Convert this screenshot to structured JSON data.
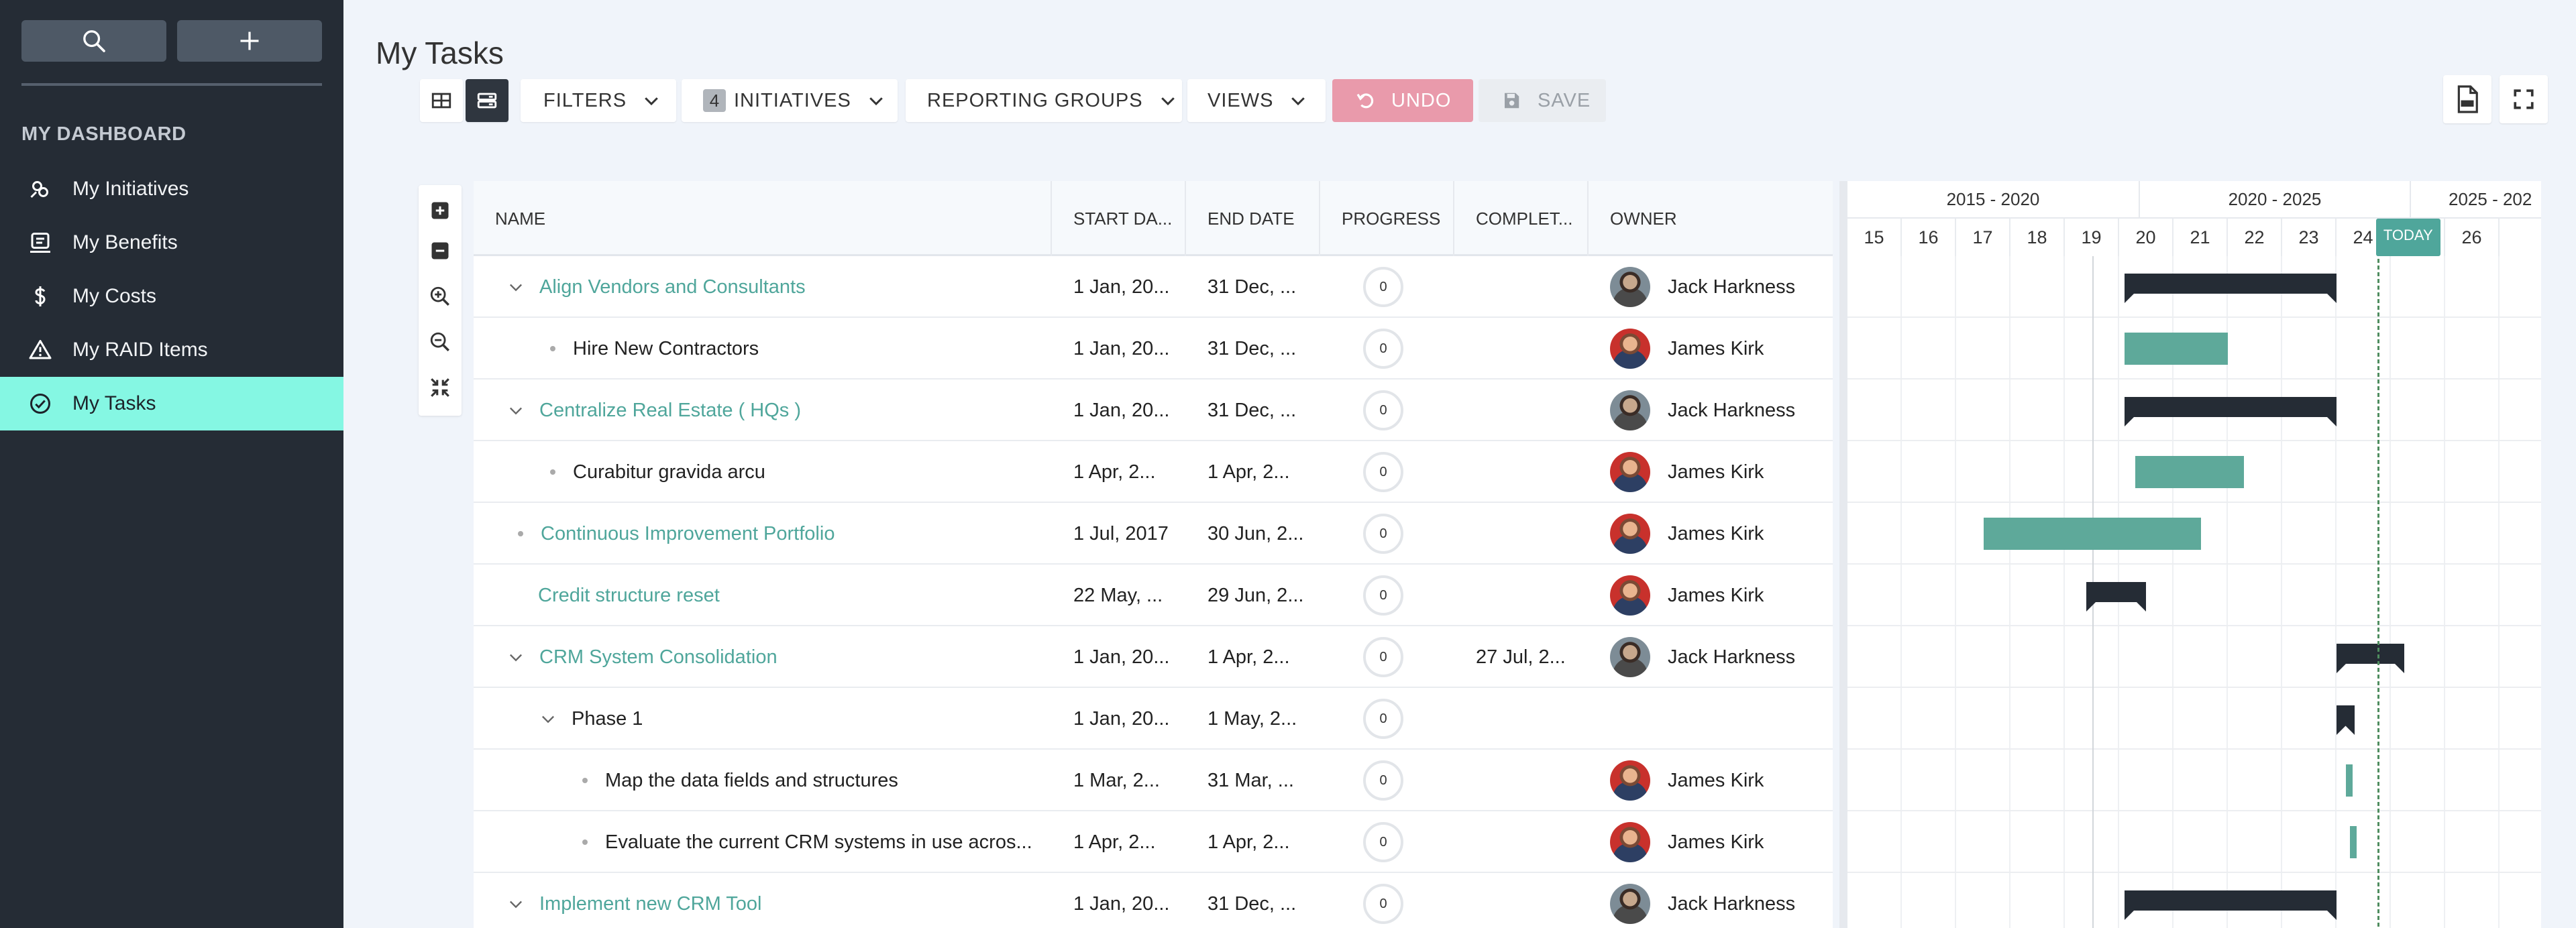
{
  "sidebar": {
    "heading": "MY DASHBOARD",
    "items": [
      {
        "label": "My Initiatives",
        "icon": "initiatives-icon"
      },
      {
        "label": "My Benefits",
        "icon": "benefits-icon"
      },
      {
        "label": "My Costs",
        "icon": "dollar-icon"
      },
      {
        "label": "My RAID Items",
        "icon": "warning-icon"
      },
      {
        "label": "My Tasks",
        "icon": "check-circle-icon",
        "active": true
      }
    ]
  },
  "page": {
    "title": "My Tasks"
  },
  "toolbar": {
    "filters": "FILTERS",
    "initiatives_count": "4",
    "initiatives": "INITIATIVES",
    "reporting_groups": "REPORTING GROUPS",
    "views": "VIEWS",
    "undo": "UNDO",
    "save": "SAVE"
  },
  "colors": {
    "accent": "#4fa69b",
    "sidebar_bg": "#252c35",
    "active_item": "#85f7e3",
    "undo_bg": "#e99aab",
    "summary_bar": "#252c35",
    "task_bar": "#5ea99a"
  },
  "columns": [
    "NAME",
    "START DA...",
    "END DATE",
    "PROGRESS",
    "COMPLET...",
    "OWNER"
  ],
  "rows": [
    {
      "name": "Align Vendors and Consultants",
      "level": 0,
      "expandable": true,
      "link": true,
      "start": "1 Jan, 20...",
      "end": "31 Dec, ...",
      "progress": "0",
      "completed": "",
      "owner": "Jack Harkness",
      "avatar": "jack"
    },
    {
      "name": "Hire New Contractors",
      "level": 1,
      "bullet": true,
      "link": false,
      "start": "1 Jan, 20...",
      "end": "31 Dec, ...",
      "progress": "0",
      "completed": "",
      "owner": "James Kirk",
      "avatar": "kirk"
    },
    {
      "name": "Centralize Real Estate ( HQs )",
      "level": 0,
      "expandable": true,
      "link": true,
      "start": "1 Jan, 20...",
      "end": "31 Dec, ...",
      "progress": "0",
      "completed": "",
      "owner": "Jack Harkness",
      "avatar": "jack"
    },
    {
      "name": "Curabitur gravida arcu",
      "level": 1,
      "bullet": true,
      "link": false,
      "start": "1 Apr, 2...",
      "end": "1 Apr, 2...",
      "progress": "0",
      "completed": "",
      "owner": "James Kirk",
      "avatar": "kirk"
    },
    {
      "name": "Continuous Improvement Portfolio",
      "level": 0,
      "bullet": true,
      "link": true,
      "start": "1 Jul, 2017",
      "end": "30 Jun, 2...",
      "progress": "0",
      "completed": "",
      "owner": "James Kirk",
      "avatar": "kirk"
    },
    {
      "name": "Credit structure reset",
      "level": 0,
      "link": true,
      "start": "22 May, ...",
      "end": "29 Jun, 2...",
      "progress": "0",
      "completed": "",
      "owner": "James Kirk",
      "avatar": "kirk"
    },
    {
      "name": "CRM System Consolidation",
      "level": 0,
      "expandable": true,
      "link": true,
      "start": "1 Jan, 20...",
      "end": "1 Apr, 2...",
      "progress": "0",
      "completed": "27 Jul, 2...",
      "owner": "Jack Harkness",
      "avatar": "jack"
    },
    {
      "name": "Phase 1",
      "level": 1,
      "expandable": true,
      "link": false,
      "start": "1 Jan, 20...",
      "end": "1 May, 2...",
      "progress": "0",
      "completed": "",
      "owner": "",
      "avatar": ""
    },
    {
      "name": "Map the data fields and structures",
      "level": 2,
      "bullet": true,
      "link": false,
      "start": "1 Mar, 2...",
      "end": "31 Mar, ...",
      "progress": "0",
      "completed": "",
      "owner": "James Kirk",
      "avatar": "kirk"
    },
    {
      "name": "Evaluate the current CRM systems in use acros...",
      "level": 2,
      "bullet": true,
      "link": false,
      "start": "1 Apr, 2...",
      "end": "1 Apr, 2...",
      "progress": "0",
      "completed": "",
      "owner": "James Kirk",
      "avatar": "kirk"
    },
    {
      "name": "Implement new CRM Tool",
      "level": 0,
      "expandable": true,
      "link": true,
      "start": "1 Jan, 20...",
      "end": "31 Dec, ...",
      "progress": "0",
      "completed": "",
      "owner": "Jack Harkness",
      "avatar": "jack"
    }
  ],
  "gantt": {
    "eras": [
      "2015 - 2020",
      "2020 - 2025",
      "2025 - 202"
    ],
    "years": [
      "15",
      "16",
      "17",
      "18",
      "19",
      "20",
      "21",
      "22",
      "23",
      "24",
      "",
      "26"
    ],
    "today_label": "TODAY",
    "today_year": 24.75,
    "bars": [
      {
        "row": 0,
        "type": "summary",
        "start": 20.1,
        "end": 24.0
      },
      {
        "row": 1,
        "type": "task",
        "start": 20.1,
        "end": 22.0
      },
      {
        "row": 2,
        "type": "summary",
        "start": 20.1,
        "end": 24.0
      },
      {
        "row": 3,
        "type": "task",
        "start": 20.3,
        "end": 22.3
      },
      {
        "row": 4,
        "type": "task",
        "start": 17.5,
        "end": 21.5
      },
      {
        "row": 5,
        "type": "summary",
        "start": 19.4,
        "end": 20.5
      },
      {
        "row": 6,
        "type": "summary",
        "start": 24.0,
        "end": 25.25
      },
      {
        "row": 7,
        "type": "summary",
        "start": 24.0,
        "end": 24.33
      },
      {
        "row": 8,
        "type": "task",
        "start": 24.17,
        "end": 24.25
      },
      {
        "row": 9,
        "type": "task",
        "start": 24.25,
        "end": 24.33
      },
      {
        "row": 10,
        "type": "summary",
        "start": 20.1,
        "end": 24.0
      }
    ]
  }
}
